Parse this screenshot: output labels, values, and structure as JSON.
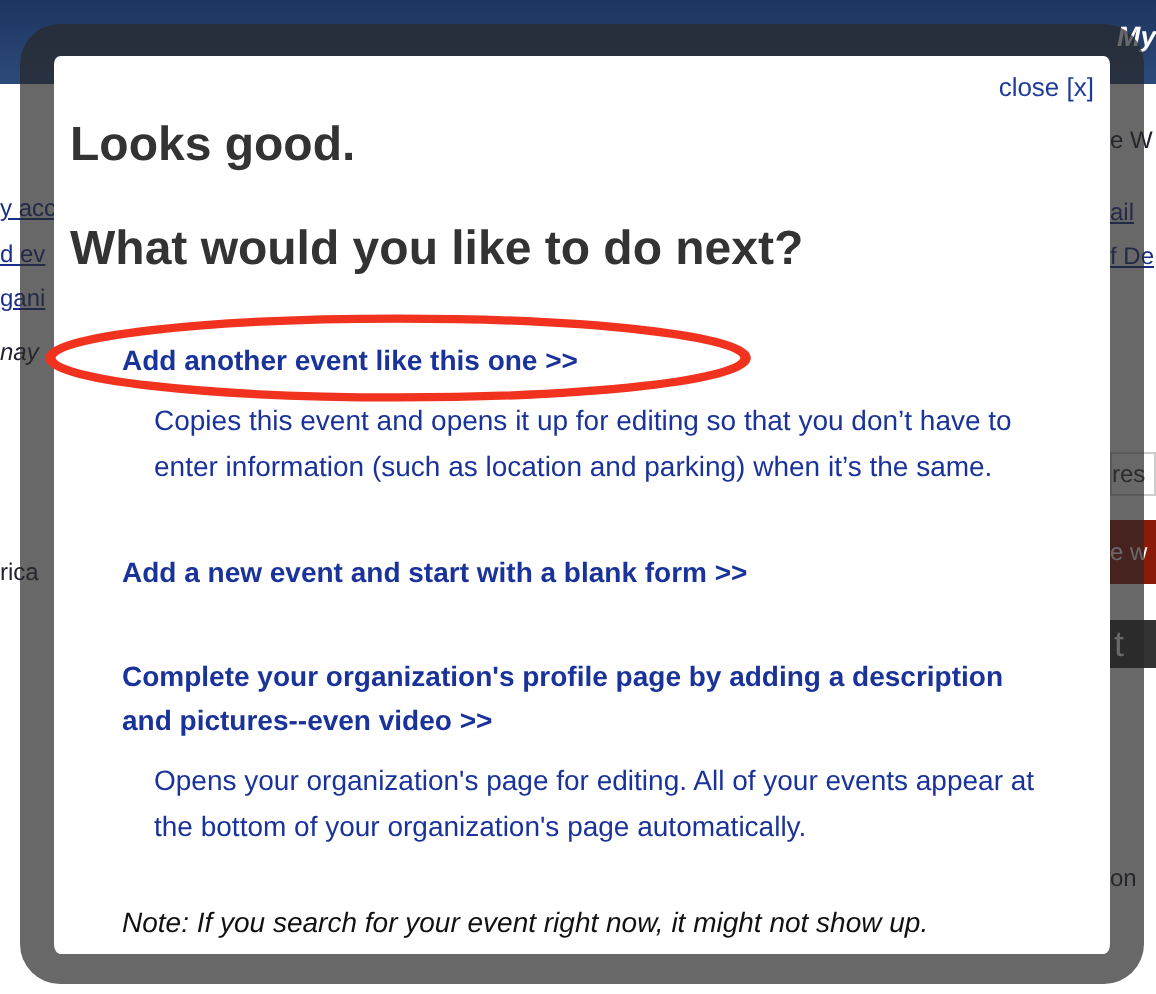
{
  "background": {
    "banner_text": "My",
    "left": [
      {
        "kind": "link",
        "text": "y acc"
      },
      {
        "kind": "link",
        "text": "d ev"
      },
      {
        "kind": "link",
        "text": "gani"
      },
      {
        "kind": "italic",
        "text": "nay"
      },
      {
        "kind": "plain",
        "text": "rica"
      }
    ],
    "right": [
      {
        "kind": "plain",
        "text": "e W"
      },
      {
        "kind": "link",
        "text": "ail"
      },
      {
        "kind": "link",
        "text": "f De"
      },
      {
        "kind": "input",
        "text": "res"
      },
      {
        "kind": "button",
        "text": "e w"
      },
      {
        "kind": "dark",
        "text": "t"
      },
      {
        "kind": "plain",
        "text": "on"
      }
    ]
  },
  "dialog": {
    "close": "close [x]",
    "title": "Looks good.",
    "question": "What would you like to do next?",
    "options": [
      {
        "link": "Add another event like this one >>",
        "description": "Copies this event and opens it up for editing so that you don’t have to enter information (such as location and parking) when it’s the same.",
        "highlighted": true
      },
      {
        "link": "Add a new event and start with a blank form >>",
        "highlighted": false
      },
      {
        "link": "Complete your organization's profile page by adding a description and pictures--even video >>",
        "description": "Opens your organization's page for editing. All of your events appear at the bottom of your organization's page automatically.",
        "highlighted": false
      }
    ],
    "note": "Note: If you search for your event right now, it might not show up."
  }
}
